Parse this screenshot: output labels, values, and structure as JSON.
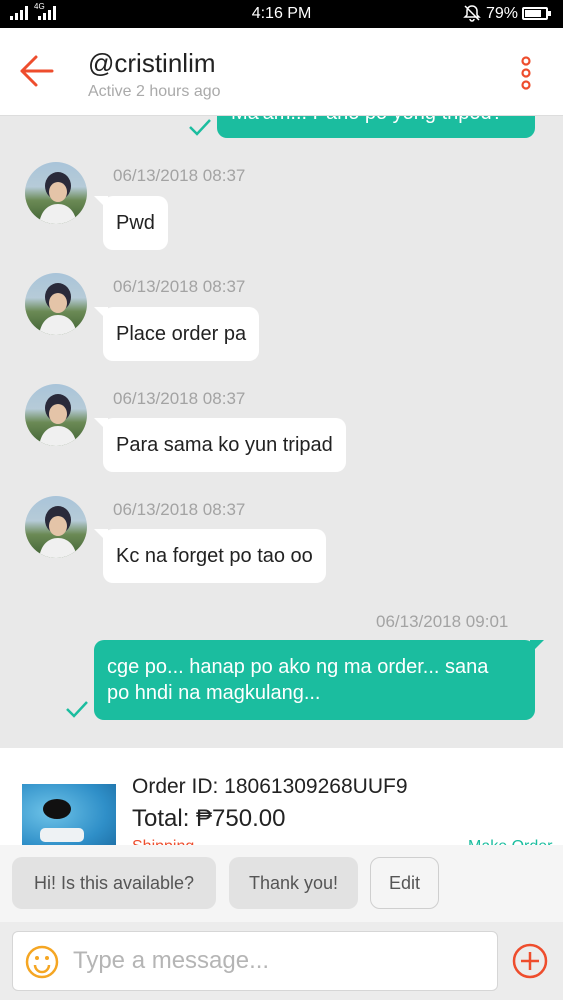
{
  "status_bar": {
    "time": "4:16 PM",
    "network": "4G",
    "battery": "79%",
    "battery_level": 0.79,
    "icons": [
      "signal-icon",
      "signal-icon",
      "mute-bell-icon",
      "battery-icon"
    ]
  },
  "header": {
    "username": "@cristinlim",
    "status": "Active 2 hours ago",
    "back_icon": "back-arrow-icon",
    "menu_icon": "more-vertical-icon"
  },
  "messages": {
    "top_partial": "Ma'am... Pano po yong tripod?",
    "incoming": [
      {
        "timestamp": "06/13/2018 08:37",
        "text": "Pwd"
      },
      {
        "timestamp": "06/13/2018 08:37",
        "text": "Place order pa"
      },
      {
        "timestamp": "06/13/2018 08:37",
        "text": "Para sama ko yun tripad"
      },
      {
        "timestamp": "06/13/2018 08:37",
        "text": "Kc na forget po tao oo"
      }
    ],
    "outgoing": {
      "timestamp": "06/13/2018 09:01",
      "line1": "cge po... hanap po ako ng ma order... sana",
      "line2": "po hndi na magkulang..."
    }
  },
  "order": {
    "id_label": "Order ID: 18061309268UUF9",
    "total_label": "Total: ₱750.00",
    "status": "Shipping",
    "link": "Make Order"
  },
  "quick_replies": [
    "Hi! Is this available?",
    "Thank you!",
    "Edit"
  ],
  "input": {
    "placeholder": "Type a message...",
    "emoji_icon": "emoji-icon",
    "add_icon": "plus-circle-icon"
  },
  "colors": {
    "accent": "#ee4d2d",
    "bubble_out": "#1bbd9f",
    "chat_bg": "#e9e9e9"
  }
}
